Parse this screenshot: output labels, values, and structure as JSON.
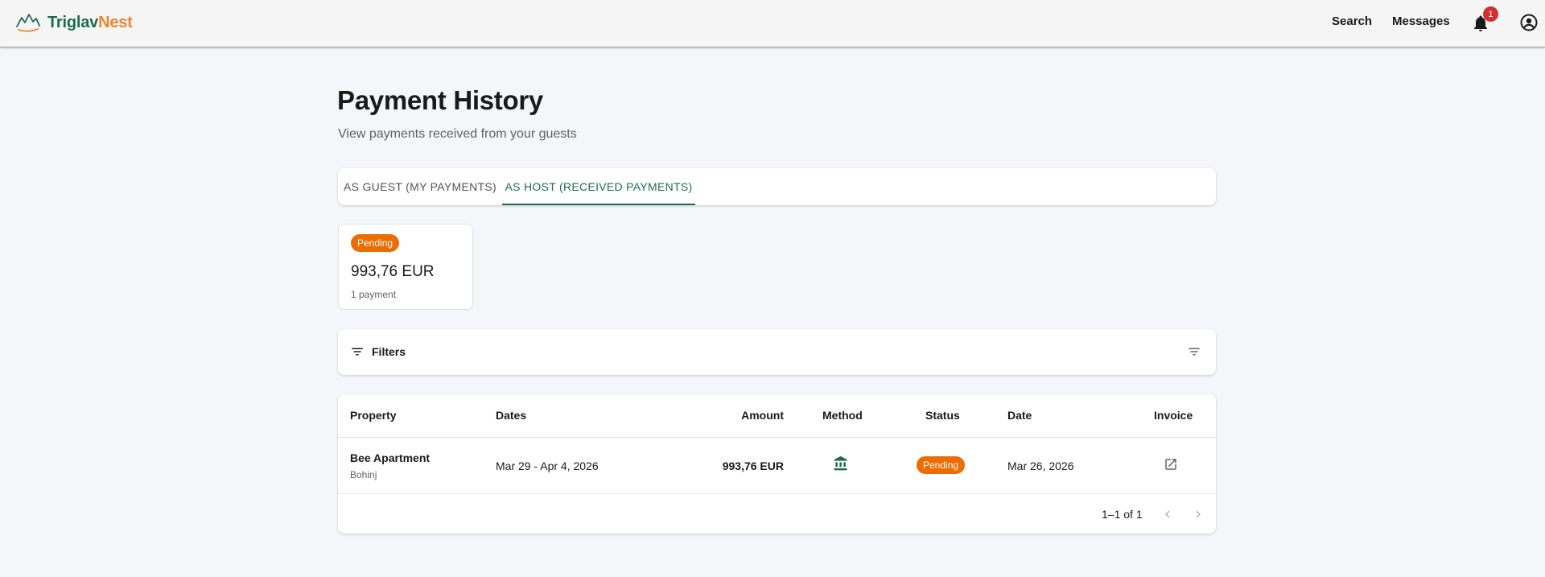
{
  "app": {
    "logo_part1": "Triglav",
    "logo_part2": "Nest",
    "brand_color": "#1e6b52",
    "accent_color": "#e8862f"
  },
  "header": {
    "nav": {
      "search": "Search",
      "messages": "Messages"
    },
    "notifications_count": "1",
    "icons": [
      "mountain-logo-icon",
      "bell-icon",
      "account-circle-icon"
    ]
  },
  "page": {
    "title": "Payment History",
    "subtitle": "View payments received from your guests"
  },
  "tabs": [
    {
      "label": "As Guest (My Payments)",
      "active": false
    },
    {
      "label": "As Host (Received Payments)",
      "active": true
    }
  ],
  "summary": {
    "status": "Pending",
    "status_color": "#ed6c02",
    "amount": "993,76 EUR",
    "count": "1 payment"
  },
  "filters": {
    "label": "Filters",
    "icons": [
      "filter-list-icon"
    ]
  },
  "table": {
    "columns": [
      "Property",
      "Dates",
      "Amount",
      "Method",
      "Status",
      "Date",
      "Invoice"
    ],
    "rows": [
      {
        "property": "Bee Apartment",
        "location": "Bohinj",
        "dates": "Mar 29 - Apr 4, 2026",
        "amount": "993,76 EUR",
        "method_icon": "bank-icon",
        "status": "Pending",
        "date": "Mar 26, 2026",
        "invoice_icon": "open-in-new-icon"
      }
    ],
    "pagination": {
      "range": "1–1 of 1"
    }
  }
}
